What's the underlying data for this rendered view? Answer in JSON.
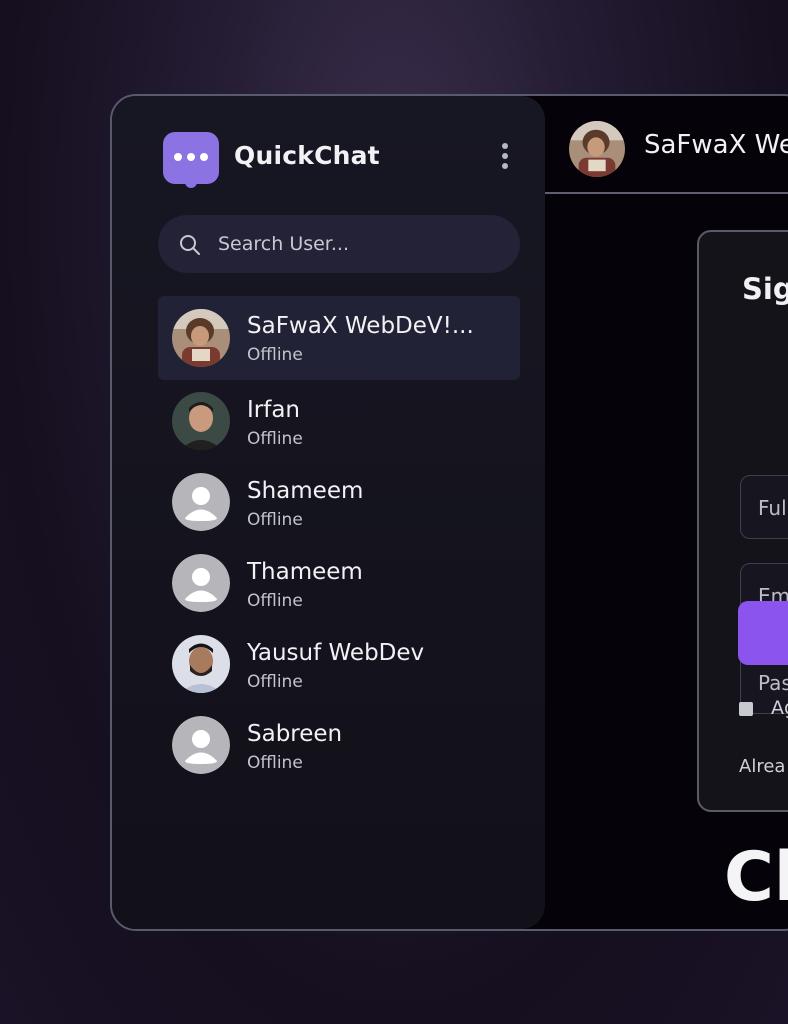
{
  "app": {
    "title": "QuickChat",
    "brand_color": "#8b73e3"
  },
  "search": {
    "placeholder": "Search User..."
  },
  "users": [
    {
      "name": "SaFwaX WebDeV!...",
      "status": "Offline",
      "avatar": "photo-child-avatar",
      "active": true
    },
    {
      "name": "Irfan",
      "status": "Offline",
      "avatar": "photo-man-avatar"
    },
    {
      "name": "Shameem",
      "status": "Offline",
      "avatar": "default-user-icon"
    },
    {
      "name": "Thameem",
      "status": "Offline",
      "avatar": "default-user-icon"
    },
    {
      "name": "Yausuf WebDev",
      "status": "Offline",
      "avatar": "photo-bearded-man-avatar"
    },
    {
      "name": "Sabreen",
      "status": "Offline",
      "avatar": "default-user-icon"
    }
  ],
  "chat_header": {
    "name": "SaFwaX We"
  },
  "signup": {
    "title": "Sig",
    "fullname_placeholder": "Full",
    "email_placeholder": "Em",
    "password_placeholder": "Pas",
    "agree_text": "Ag",
    "already_text": "Alrea",
    "button_color": "#8c54ee"
  },
  "hero": {
    "heading": "Ch"
  }
}
